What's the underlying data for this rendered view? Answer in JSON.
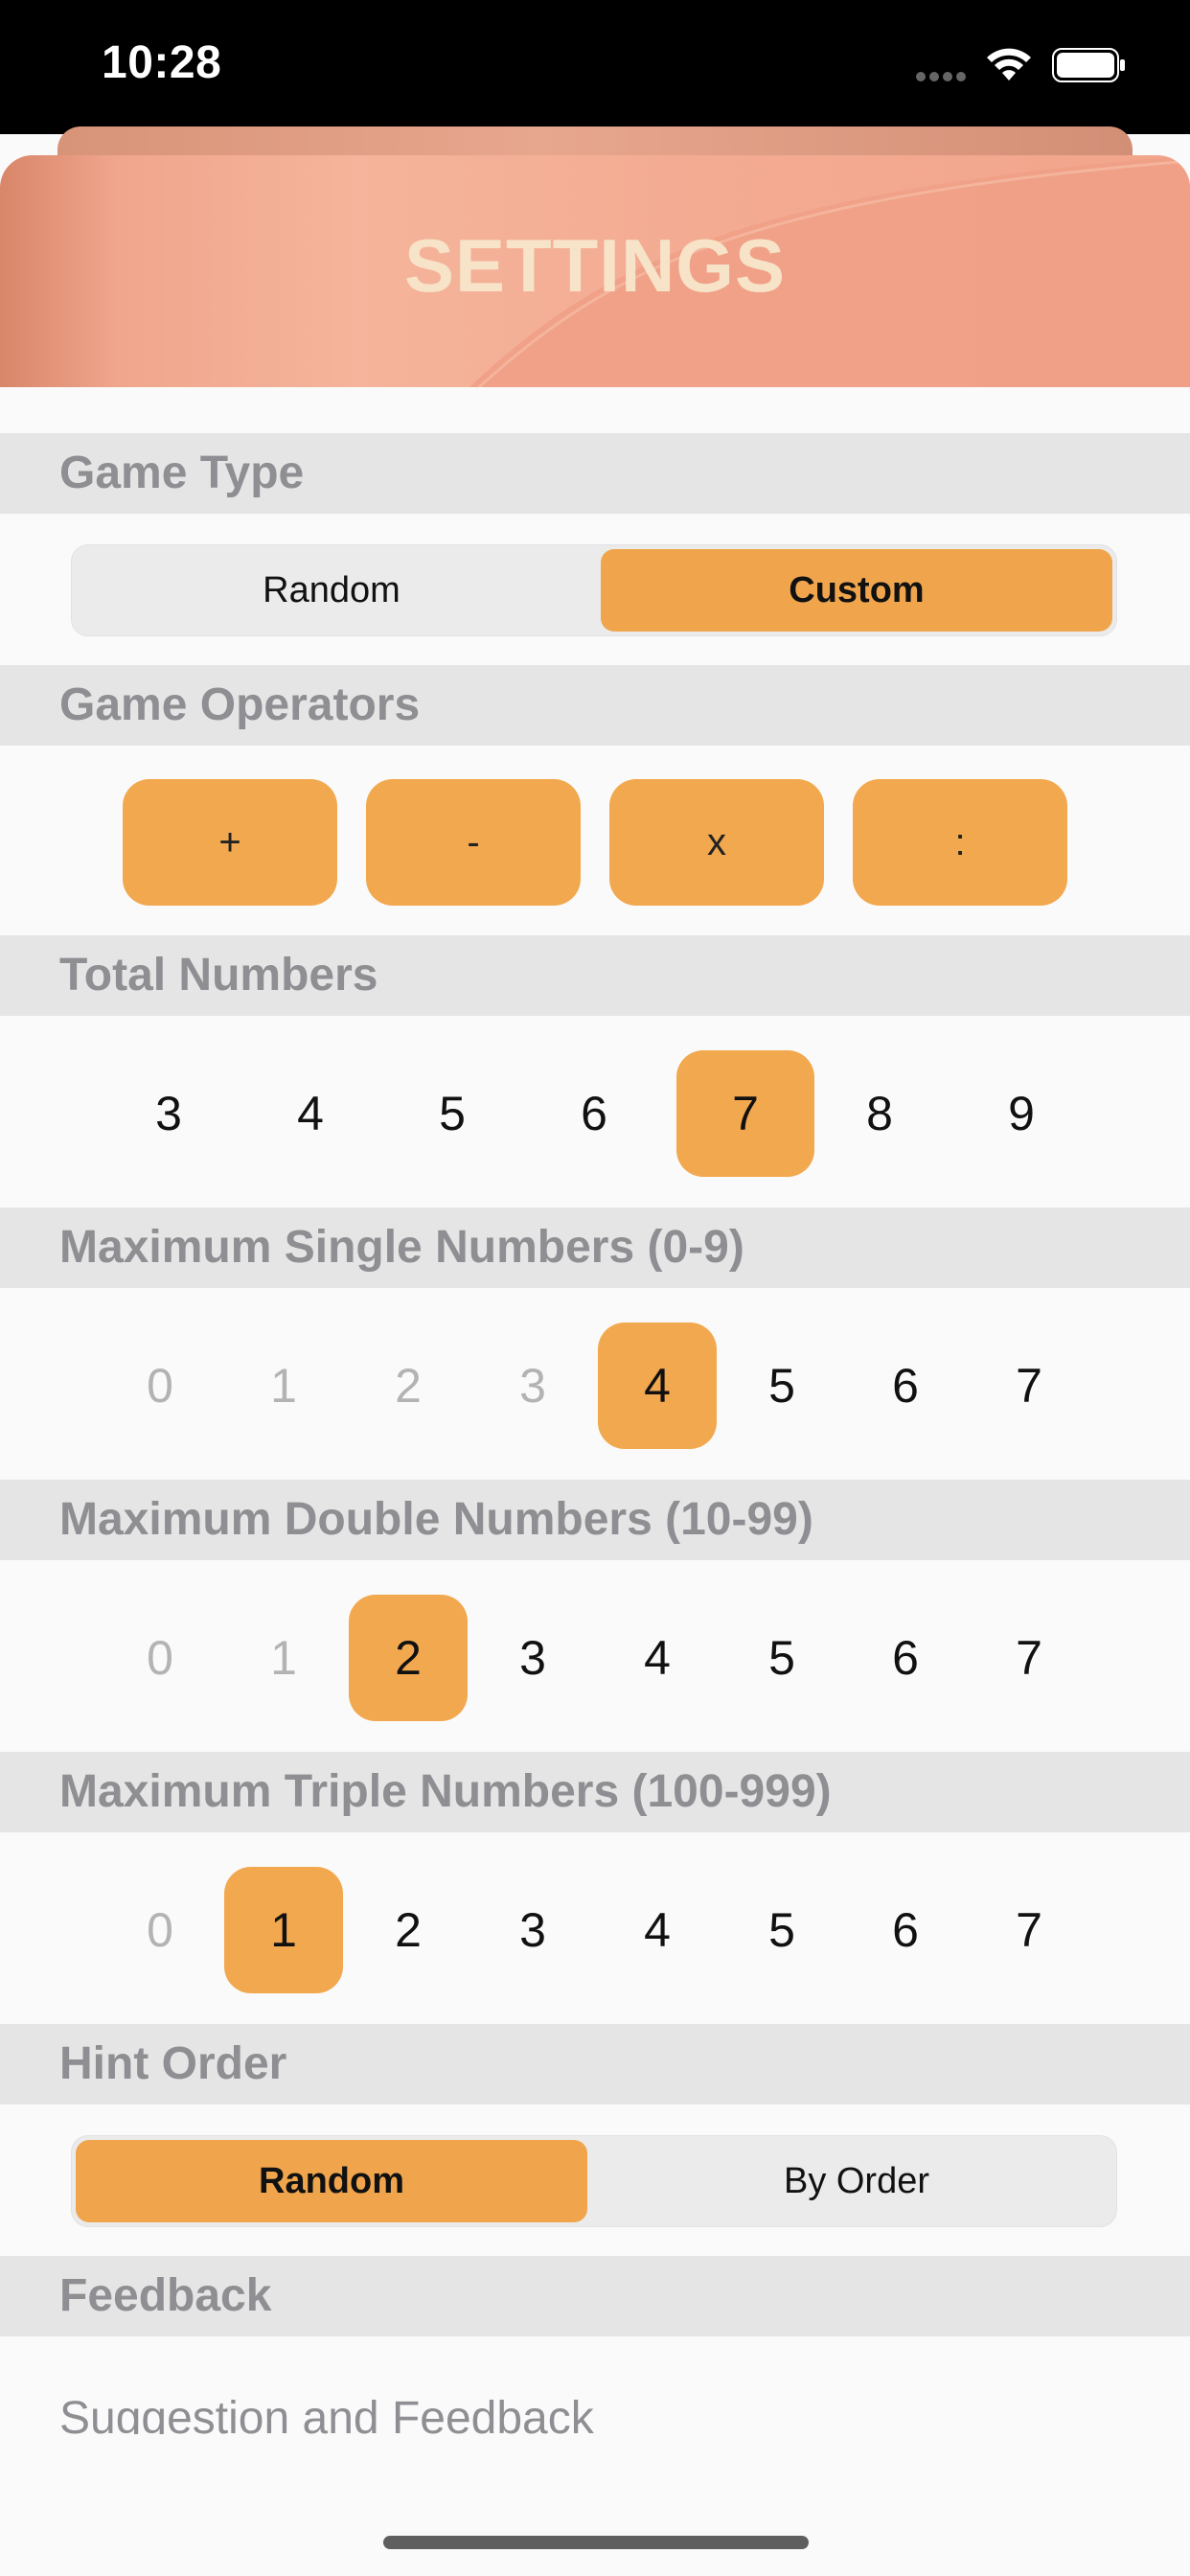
{
  "status_bar": {
    "time": "10:28"
  },
  "header": {
    "title": "SETTINGS"
  },
  "sections": {
    "game_type": {
      "label": "Game Type",
      "options": [
        "Random",
        "Custom"
      ],
      "selected": "Custom"
    },
    "game_operators": {
      "label": "Game Operators",
      "operators": [
        "+",
        "-",
        "x",
        ":"
      ]
    },
    "total_numbers": {
      "label": "Total Numbers",
      "values": [
        "3",
        "4",
        "5",
        "6",
        "7",
        "8",
        "9"
      ],
      "selected": "7"
    },
    "max_single": {
      "label": "Maximum Single Numbers (0-9)",
      "values": [
        "0",
        "1",
        "2",
        "3",
        "4",
        "5",
        "6",
        "7"
      ],
      "selected": "4"
    },
    "max_double": {
      "label": "Maximum Double Numbers (10-99)",
      "values": [
        "0",
        "1",
        "2",
        "3",
        "4",
        "5",
        "6",
        "7"
      ],
      "selected": "2"
    },
    "max_triple": {
      "label": "Maximum Triple Numbers (100-999)",
      "values": [
        "0",
        "1",
        "2",
        "3",
        "4",
        "5",
        "6",
        "7"
      ],
      "selected": "1"
    },
    "hint_order": {
      "label": "Hint Order",
      "options": [
        "Random",
        "By Order"
      ],
      "selected": "Random"
    },
    "feedback": {
      "label": "Feedback",
      "row": "Suggestion and Feedback"
    }
  },
  "colors": {
    "accent": "#f2a84e",
    "section_bg": "#e5e5e5",
    "header_title": "#f7e3c8"
  }
}
